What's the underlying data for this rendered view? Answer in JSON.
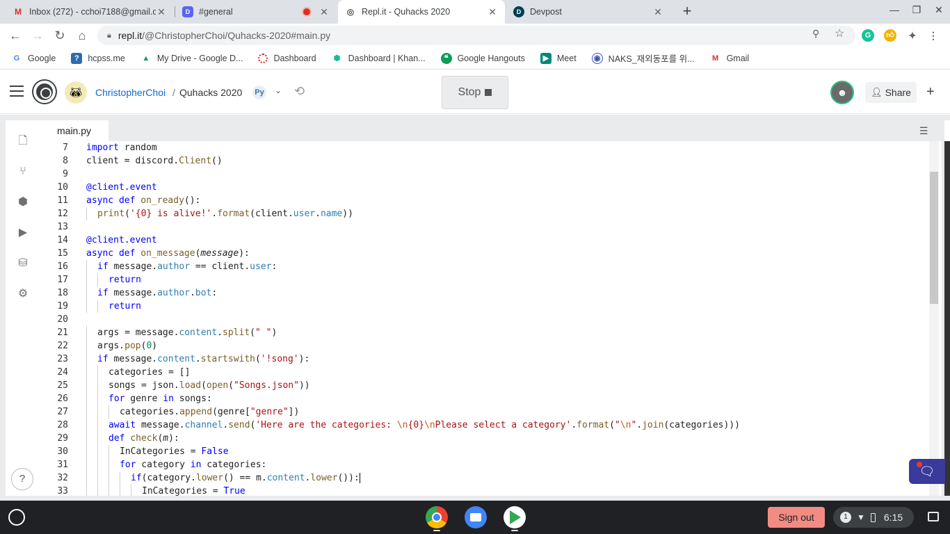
{
  "browser": {
    "tabs": [
      {
        "title": "Inbox (272) - cchoi7188@gmail.c",
        "icon": "gmail-icon",
        "close": "✕"
      },
      {
        "title": "#general",
        "icon": "discord-icon",
        "close": "✕"
      },
      {
        "title": "Repl.it - Quhacks 2020",
        "icon": "replit-icon",
        "close": "✕"
      },
      {
        "title": "Devpost",
        "icon": "devpost-icon",
        "close": "✕"
      }
    ],
    "url_host": "repl.it",
    "url_path": "/@ChristopherChoi/Quhacks-2020#main.py",
    "bookmarks": [
      {
        "label": "Google",
        "icon": "google-icon",
        "color": "#4285f4"
      },
      {
        "label": "hcpss.me",
        "icon": "hcpss-icon",
        "color": "#2b6cb0"
      },
      {
        "label": "My Drive - Google D...",
        "icon": "drive-icon",
        "color": "#0f9d58"
      },
      {
        "label": "Dashboard",
        "icon": "dashboard-icon",
        "color": "#d93025"
      },
      {
        "label": "Dashboard | Khan...",
        "icon": "khan-icon",
        "color": "#14bf96"
      },
      {
        "label": "Google Hangouts",
        "icon": "hangouts-icon",
        "color": "#0f9d58"
      },
      {
        "label": "Meet",
        "icon": "meet-icon",
        "color": "#00897b"
      },
      {
        "label": "NAKS_재외동포를 위...",
        "icon": "naks-icon",
        "color": "#3f51b5"
      },
      {
        "label": "Gmail",
        "icon": "gmail-icon",
        "color": "#d93025"
      }
    ]
  },
  "repl": {
    "username": "ChristopherChoi",
    "separator": "/",
    "repl_name": "Quhacks 2020",
    "stop_label": "Stop",
    "share_label": "Share",
    "file_tab": "main.py"
  },
  "code_lines": [
    {
      "n": "7",
      "indent": 0,
      "html": "<span>import</span> random"
    },
    {
      "n": "8",
      "indent": 0,
      "html": "client = discord.<span class=\"fn\">Client</span>()"
    },
    {
      "n": "9",
      "indent": 0,
      "html": ""
    },
    {
      "n": "10",
      "indent": 0,
      "html": "<span class=\"dec\">@client.event</span>"
    },
    {
      "n": "11",
      "indent": 0,
      "html": "<span class=\"kw\">async def</span> <span class=\"fn\">on_ready</span>():"
    },
    {
      "n": "12",
      "indent": 1,
      "html": "<span class=\"fn\">print</span>(<span class=\"str\">'{0} is alive!'</span>.<span class=\"fn\">format</span>(client.<span class=\"prop\">user</span>.<span class=\"prop\">name</span>))"
    },
    {
      "n": "13",
      "indent": 0,
      "html": ""
    },
    {
      "n": "14",
      "indent": 0,
      "html": "<span class=\"dec\">@client.event</span>"
    },
    {
      "n": "15",
      "indent": 0,
      "html": "<span class=\"kw\">async def</span> <span class=\"fn\">on_message</span>(<span class=\"it\">message</span>):"
    },
    {
      "n": "16",
      "indent": 1,
      "html": "<span class=\"kw\">if</span> message.<span class=\"prop\">author</span> == client.<span class=\"prop\">user</span>:"
    },
    {
      "n": "17",
      "indent": 2,
      "html": "<span class=\"kw\">return</span>"
    },
    {
      "n": "18",
      "indent": 1,
      "html": "<span class=\"kw\">if</span> message.<span class=\"prop\">author</span>.<span class=\"prop\">bot</span>:"
    },
    {
      "n": "19",
      "indent": 2,
      "html": "<span class=\"kw\">return</span>"
    },
    {
      "n": "20",
      "indent": 0,
      "html": ""
    },
    {
      "n": "21",
      "indent": 1,
      "html": "args = message.<span class=\"prop\">content</span>.<span class=\"fn\">split</span>(<span class=\"str\">\" \"</span>)"
    },
    {
      "n": "22",
      "indent": 1,
      "html": "args.<span class=\"fn\">pop</span>(<span class=\"num\">0</span>)"
    },
    {
      "n": "23",
      "indent": 1,
      "html": "<span class=\"kw\">if</span> message.<span class=\"prop\">content</span>.<span class=\"fn\">startswith</span>(<span class=\"str\">'!song'</span>):"
    },
    {
      "n": "24",
      "indent": 2,
      "html": "categories = []"
    },
    {
      "n": "25",
      "indent": 2,
      "html": "songs = json.<span class=\"fn\">load</span>(<span class=\"fn\">open</span>(<span class=\"str\">\"Songs.json\"</span>))"
    },
    {
      "n": "26",
      "indent": 2,
      "html": "<span class=\"kw\">for</span> genre <span class=\"kw\">in</span> songs:"
    },
    {
      "n": "27",
      "indent": 3,
      "html": "categories.<span class=\"fn\">append</span>(genre[<span class=\"str\">\"genre\"</span>])"
    },
    {
      "n": "28",
      "indent": 2,
      "html": "<span class=\"kw\">await</span> message.<span class=\"prop\">channel</span>.<span class=\"fn\">send</span>(<span class=\"str\">'Here are the categories: </span><span class=\"esc\">\\n</span><span class=\"str\">{0}</span><span class=\"esc\">\\n</span><span class=\"str\">Please select a category'</span>.<span class=\"fn\">format</span>(<span class=\"str\">\"</span><span class=\"esc\">\\n</span><span class=\"str\">\"</span>.<span class=\"fn\">join</span>(categories)))"
    },
    {
      "n": "29",
      "indent": 2,
      "html": "<span class=\"kw\">def</span> <span class=\"fn\">check</span>(<span class=\"it\">m</span>):"
    },
    {
      "n": "30",
      "indent": 3,
      "html": "InCategories = <span class=\"kw\">False</span>"
    },
    {
      "n": "31",
      "indent": 3,
      "html": "<span class=\"kw\">for</span> category <span class=\"kw\">in</span> categories:"
    },
    {
      "n": "32",
      "indent": 4,
      "html": "<span class=\"kw\">if</span>(category.<span class=\"fn\">lower</span>() == m.<span class=\"prop\">content</span>.<span class=\"fn\">lower</span>()):<span class=\"cursor\"></span>"
    },
    {
      "n": "33",
      "indent": 5,
      "html": "InCategories = <span class=\"kw\">True</span>"
    }
  ],
  "shelf": {
    "signout_label": "Sign out",
    "notification_count": "1",
    "time": "6:15",
    "apps": [
      "chrome-icon",
      "files-icon",
      "play-store-icon"
    ]
  }
}
